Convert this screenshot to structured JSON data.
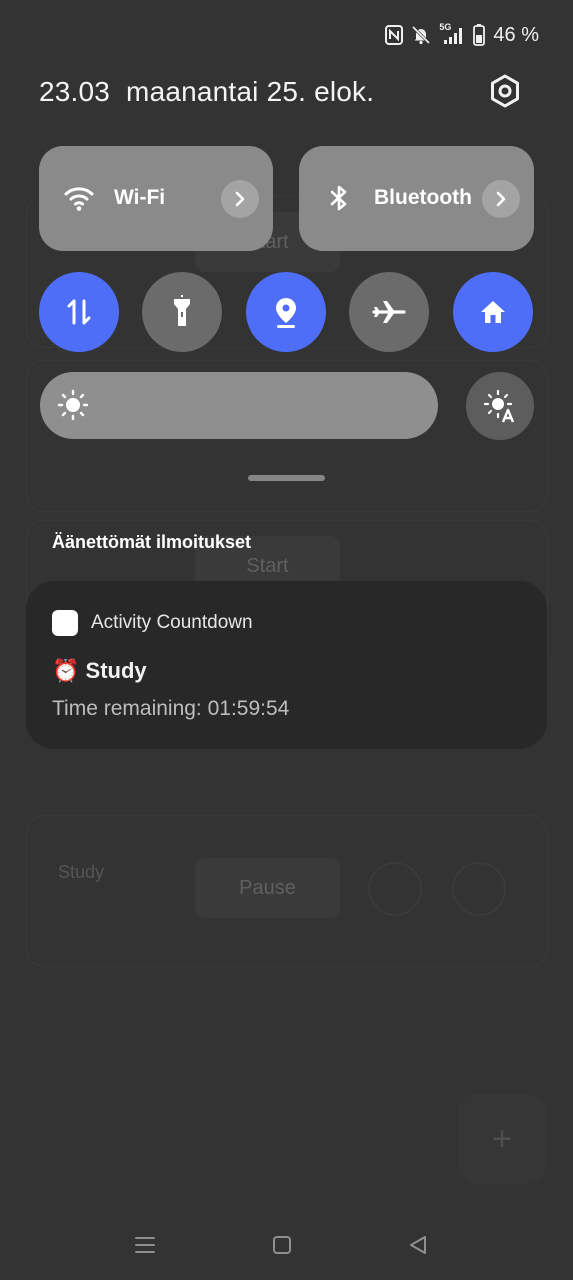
{
  "background_app": {
    "start_label": "Start",
    "pause_label": "Pause",
    "study_title": "Study",
    "fab_icon": "plus-icon"
  },
  "status_bar": {
    "nfc_icon": "nfc-icon",
    "mute_icon": "bell-off-icon",
    "network": "5G",
    "battery": "46 %"
  },
  "header": {
    "time": "23.03",
    "date": "maanantai 25. elok.",
    "settings_icon": "gear-icon"
  },
  "tiles": {
    "wifi": {
      "label": "Wi-Fi",
      "icon": "wifi-icon"
    },
    "bluetooth": {
      "label": "Bluetooth",
      "icon": "bluetooth-icon"
    }
  },
  "quick_buttons": [
    {
      "name": "mobile-data",
      "icon": "data-arrows-icon",
      "active": true
    },
    {
      "name": "flashlight",
      "icon": "flashlight-icon",
      "active": false
    },
    {
      "name": "location",
      "icon": "location-icon",
      "active": true
    },
    {
      "name": "airplane-mode",
      "icon": "airplane-icon",
      "active": false
    },
    {
      "name": "home",
      "icon": "home-icon",
      "active": true
    }
  ],
  "brightness": {
    "icon": "sun-icon",
    "auto_icon": "auto-brightness-icon"
  },
  "section": {
    "title": "Äänettömät ilmoitukset"
  },
  "notification": {
    "app_name": "Activity Countdown",
    "title_emoji": "⏰",
    "title": "Study",
    "body": "Time remaining: 01:59:54"
  },
  "colors": {
    "accent": "#4f6ef7",
    "panel": "#333333",
    "tile": "#8a8a8a",
    "notification_bg": "#282828"
  }
}
